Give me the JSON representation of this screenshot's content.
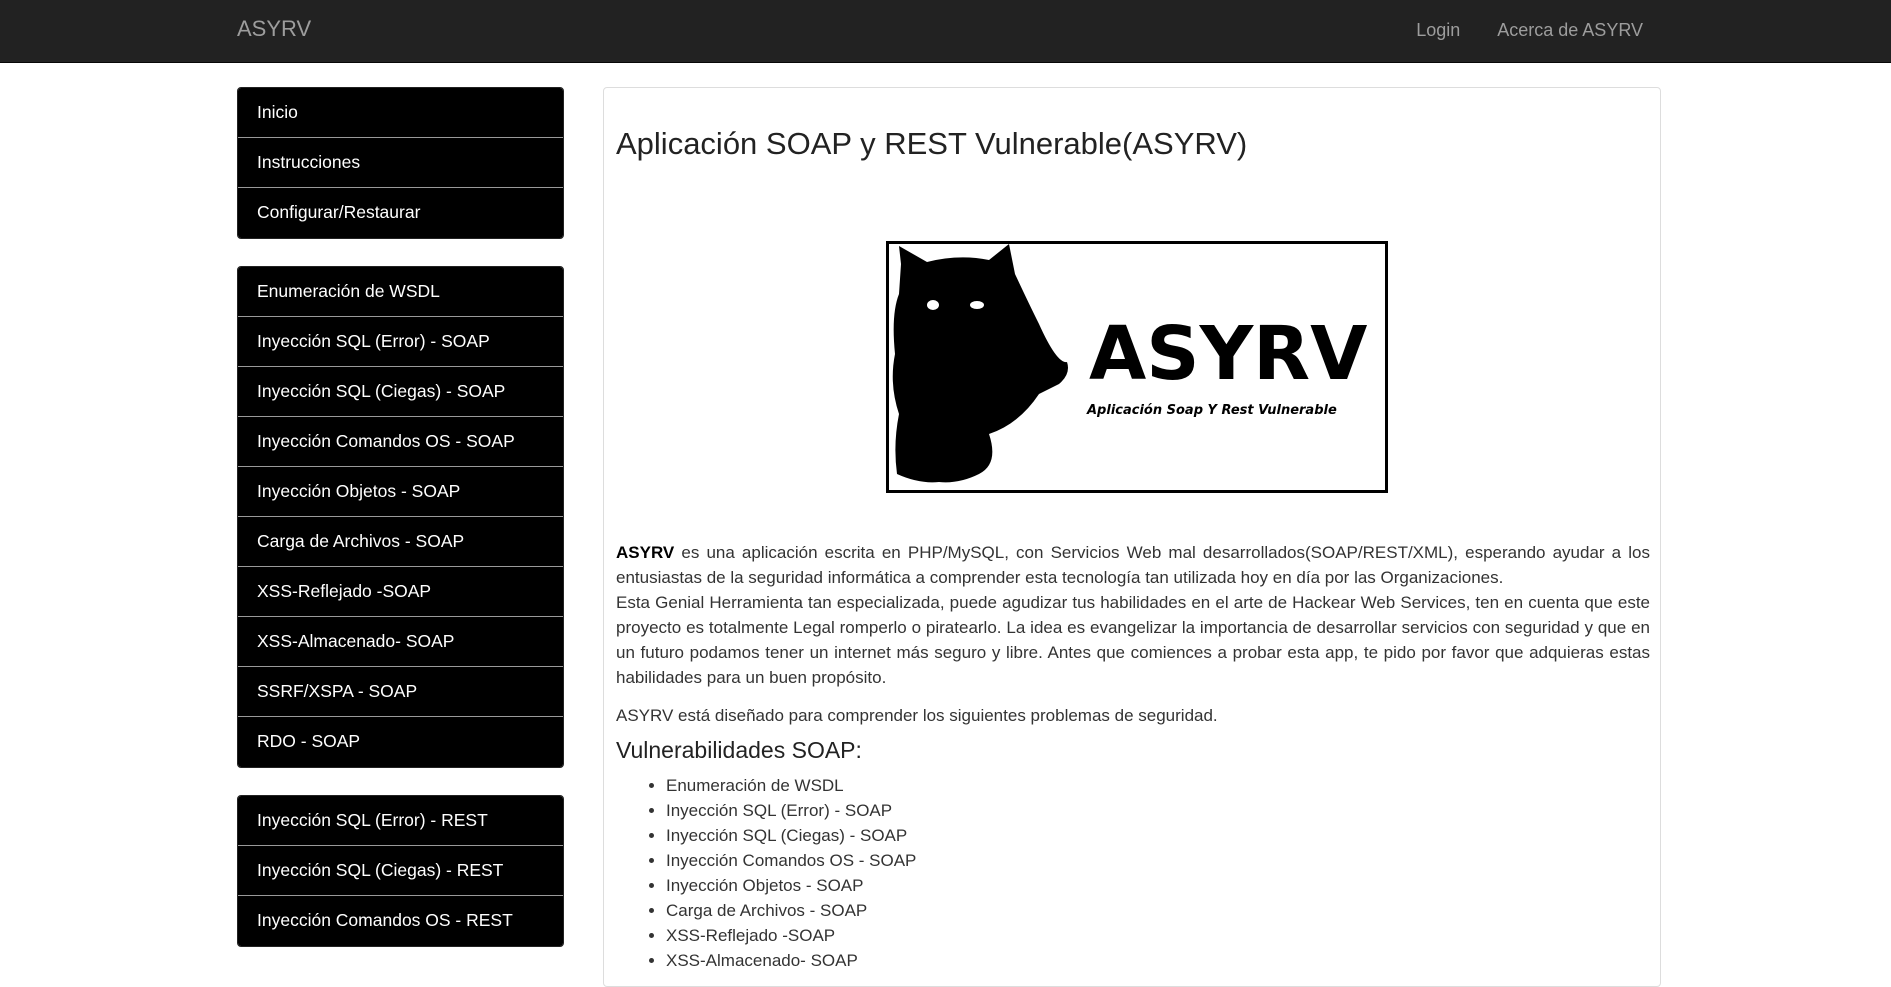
{
  "navbar": {
    "brand": "ASYRV",
    "links": [
      "Login",
      "Acerca de ASYRV"
    ]
  },
  "sidebar": {
    "group1": [
      "Inicio",
      "Instrucciones",
      "Configurar/Restaurar"
    ],
    "group2": [
      "Enumeración de WSDL",
      "Inyección SQL (Error) - SOAP",
      "Inyección SQL (Ciegas) - SOAP",
      "Inyección Comandos OS - SOAP",
      "Inyección Objetos - SOAP",
      "Carga de Archivos - SOAP",
      "XSS-Reflejado -SOAP",
      "XSS-Almacenado- SOAP",
      "SSRF/XSPA - SOAP",
      "RDO - SOAP"
    ],
    "group3": [
      "Inyección SQL (Error) - REST",
      "Inyección SQL (Ciegas) - REST",
      "Inyección Comandos OS - REST"
    ]
  },
  "main": {
    "title": "Aplicación SOAP y REST Vulnerable(ASYRV)",
    "logo": {
      "text": "ASYRV",
      "subtitle": "Aplicación Soap Y Rest Vulnerable"
    },
    "description": {
      "strong": "ASYRV",
      "line1": " es una aplicación escrita en PHP/MySQL, con Servicios Web mal desarrollados(SOAP/REST/XML), esperando ayudar a los entusiastas de la seguridad informática a comprender esta tecnología tan utilizada hoy en día por las Organizaciones.",
      "line2": "Esta Genial Herramienta tan especializada, puede agudizar tus habilidades en el arte de Hackear Web Services, ten en cuenta que este proyecto es totalmente Legal romperlo o piratearlo. La idea es evangelizar la importancia de desarrollar servicios con seguridad y que en un futuro podamos tener un internet más seguro y libre. Antes que comiences a probar esta app, te pido por favor que adquieras estas habilidades para un buen propósito."
    },
    "designed": "ASYRV está diseñado para comprender los siguientes problemas de seguridad.",
    "vuln_title": "Vulnerabilidades SOAP:",
    "vuln_list": [
      "Enumeración de WSDL",
      "Inyección SQL (Error) - SOAP",
      "Inyección SQL (Ciegas) - SOAP",
      "Inyección Comandos OS - SOAP",
      "Inyección Objetos - SOAP",
      "Carga de Archivos - SOAP",
      "XSS-Reflejado -SOAP",
      "XSS-Almacenado- SOAP"
    ]
  }
}
